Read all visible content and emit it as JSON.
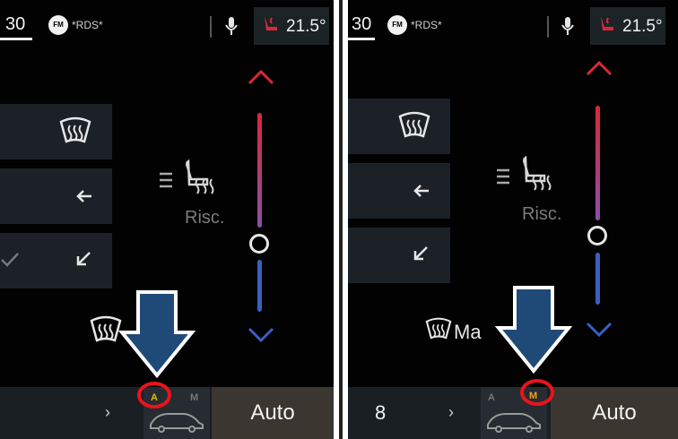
{
  "left_panel": {
    "status": {
      "station_partial": "30",
      "fm_badge": "FM",
      "station_name": "*RDS*",
      "temperature": "21.5°"
    },
    "side_buttons": [
      {
        "icon": "windshield-defrost-icon"
      },
      {
        "icon": "arrow-left-icon"
      },
      {
        "icon": "arrow-down-left-icon"
      }
    ],
    "seat_heat_label": "Risc.",
    "bottom": {
      "mode_auto_letter": "A",
      "mode_manual_letter": "M",
      "auto_label": "Auto"
    }
  },
  "right_panel": {
    "status": {
      "station_partial": "30",
      "fm_badge": "FM",
      "station_name": "*RDS*",
      "temperature": "21.5°"
    },
    "side_buttons": [
      {
        "icon": "windshield-defrost-icon"
      },
      {
        "icon": "arrow-left-icon"
      },
      {
        "icon": "arrow-down-left-icon"
      }
    ],
    "seat_heat_label": "Risc.",
    "defrost_label": "Ma",
    "bottom": {
      "fan_number": "8",
      "mode_auto_letter": "A",
      "mode_manual_letter": "M",
      "auto_label": "Auto"
    }
  },
  "colors": {
    "background": "#020202",
    "tile": "#1b2126",
    "heat_red": "#d8283a",
    "cool_blue": "#3a5fc0",
    "auto_active_yellow": "#e3c000",
    "manual_active_orange": "#f0a020",
    "highlight_circle": "#e8141c",
    "pointer_arrow": "#1f4a78"
  }
}
